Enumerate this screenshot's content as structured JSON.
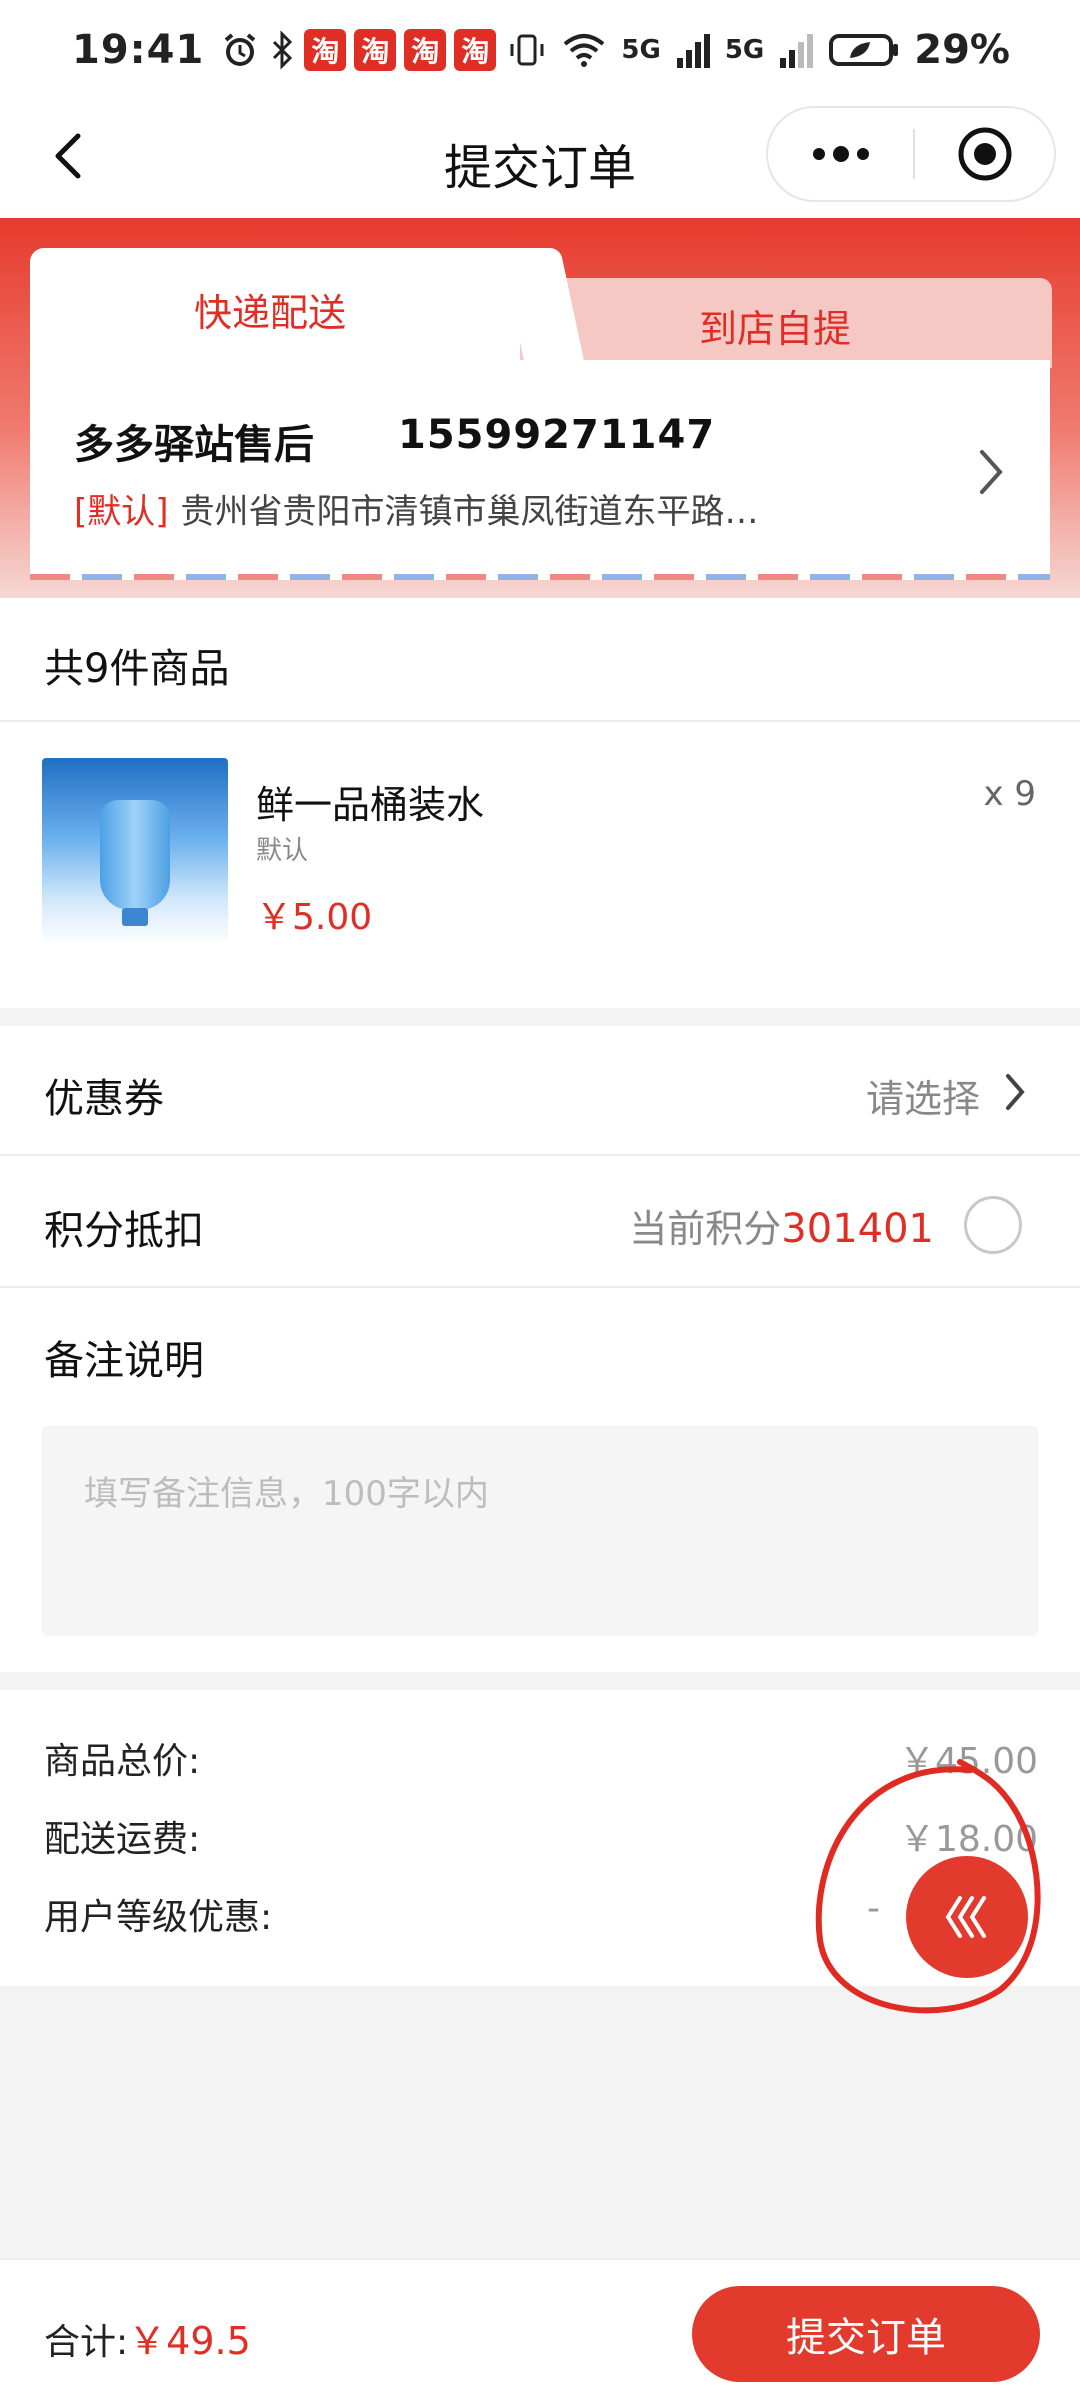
{
  "status_bar": {
    "time": "19:41",
    "battery": "29%",
    "taobao_badges": [
      "淘",
      "淘",
      "淘",
      "淘"
    ],
    "net_1": "5G",
    "net_2": "5G"
  },
  "nav": {
    "title": "提交订单"
  },
  "delivery_tabs": {
    "active": "快递配送",
    "inactive": "到店自提"
  },
  "address": {
    "name": "多多驿站售后",
    "phone": "15599271147",
    "default_tag": "[默认]",
    "detail": "贵州省贵阳市清镇市巢凤街道东平路…"
  },
  "products": {
    "count_text": "共9件商品",
    "items": [
      {
        "name": "鲜一品桶装水",
        "spec": "默认",
        "price": "￥5.00",
        "qty": "x 9"
      }
    ]
  },
  "coupon": {
    "label": "优惠券",
    "value": "请选择"
  },
  "points": {
    "label": "积分抵扣",
    "prefix": "当前积分",
    "value": "301401"
  },
  "remark": {
    "label": "备注说明",
    "placeholder": "填写备注信息，100字以内"
  },
  "summary": {
    "goods_total_label": "商品总价:",
    "goods_total_value": "￥45.00",
    "shipping_label": "配送运费:",
    "shipping_value": "￥18.00",
    "level_discount_label": "用户等级优惠:",
    "level_discount_value": "-"
  },
  "footer": {
    "total_label": "合计:",
    "total_value": "￥49.5",
    "submit_label": "提交订单"
  },
  "colors": {
    "accent": "#e23a2d",
    "price": "#e02e24"
  }
}
